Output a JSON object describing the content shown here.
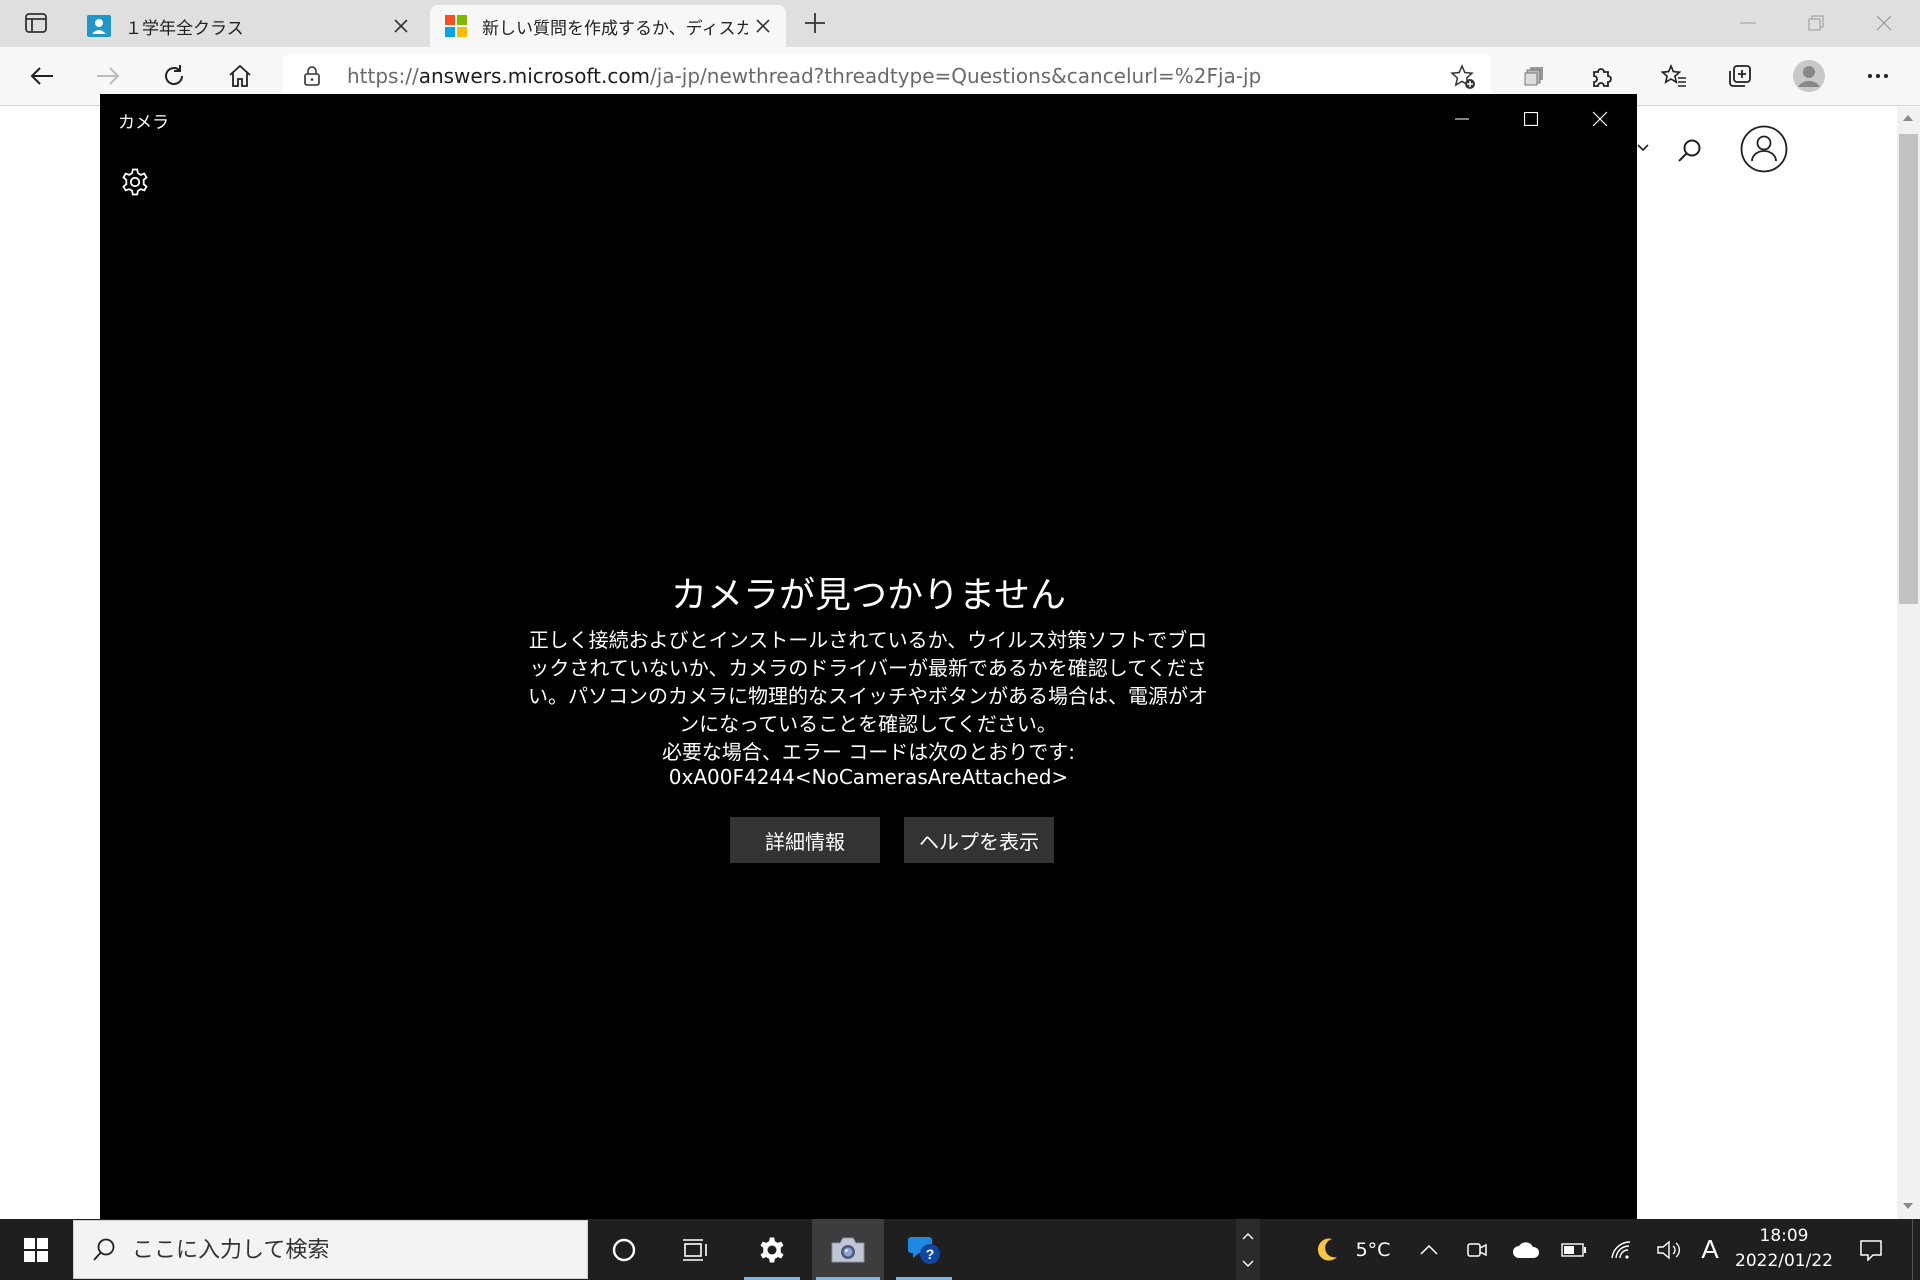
{
  "browser": {
    "tabs": [
      {
        "label": "１学年全クラス",
        "active": false
      },
      {
        "label": "新しい質問を作成するか、ディスカッション",
        "active": true
      }
    ],
    "url": {
      "scheme": "https://",
      "host": "answers.microsoft.com",
      "path": "/ja-jp/newthread?threadtype=Questions&cancelurl=%2Fja-jp"
    }
  },
  "camera": {
    "window_title": "カメラ",
    "error_title": "カメラが見つかりません",
    "error_body": "正しく接続およびとインストールされているか、ウイルス対策ソフトでブロックされていないか、カメラのドライバーが最新であるかを確認してください。パソコンのカメラに物理的なスイッチやボタンがある場合は、電源がオンになっていることを確認してください。",
    "error_code_label": "必要な場合、エラー コードは次のとおりです:",
    "error_code": "0xA00F4244<NoCamerasAreAttached>",
    "buttons": {
      "details": "詳細情報",
      "help": "ヘルプを表示"
    }
  },
  "taskbar": {
    "search_placeholder": "ここに入力して検索",
    "weather": "5°C",
    "ime": "A",
    "time": "18:09",
    "date": "2022/01/22"
  },
  "colors": {
    "tab_bar": "#dfdfdf",
    "toolbar": "#f7f7f7",
    "camera_bg": "#000000",
    "camera_button": "#333333",
    "taskbar": "#1f1f1f",
    "taskbar_accent": "#76b9ed"
  }
}
